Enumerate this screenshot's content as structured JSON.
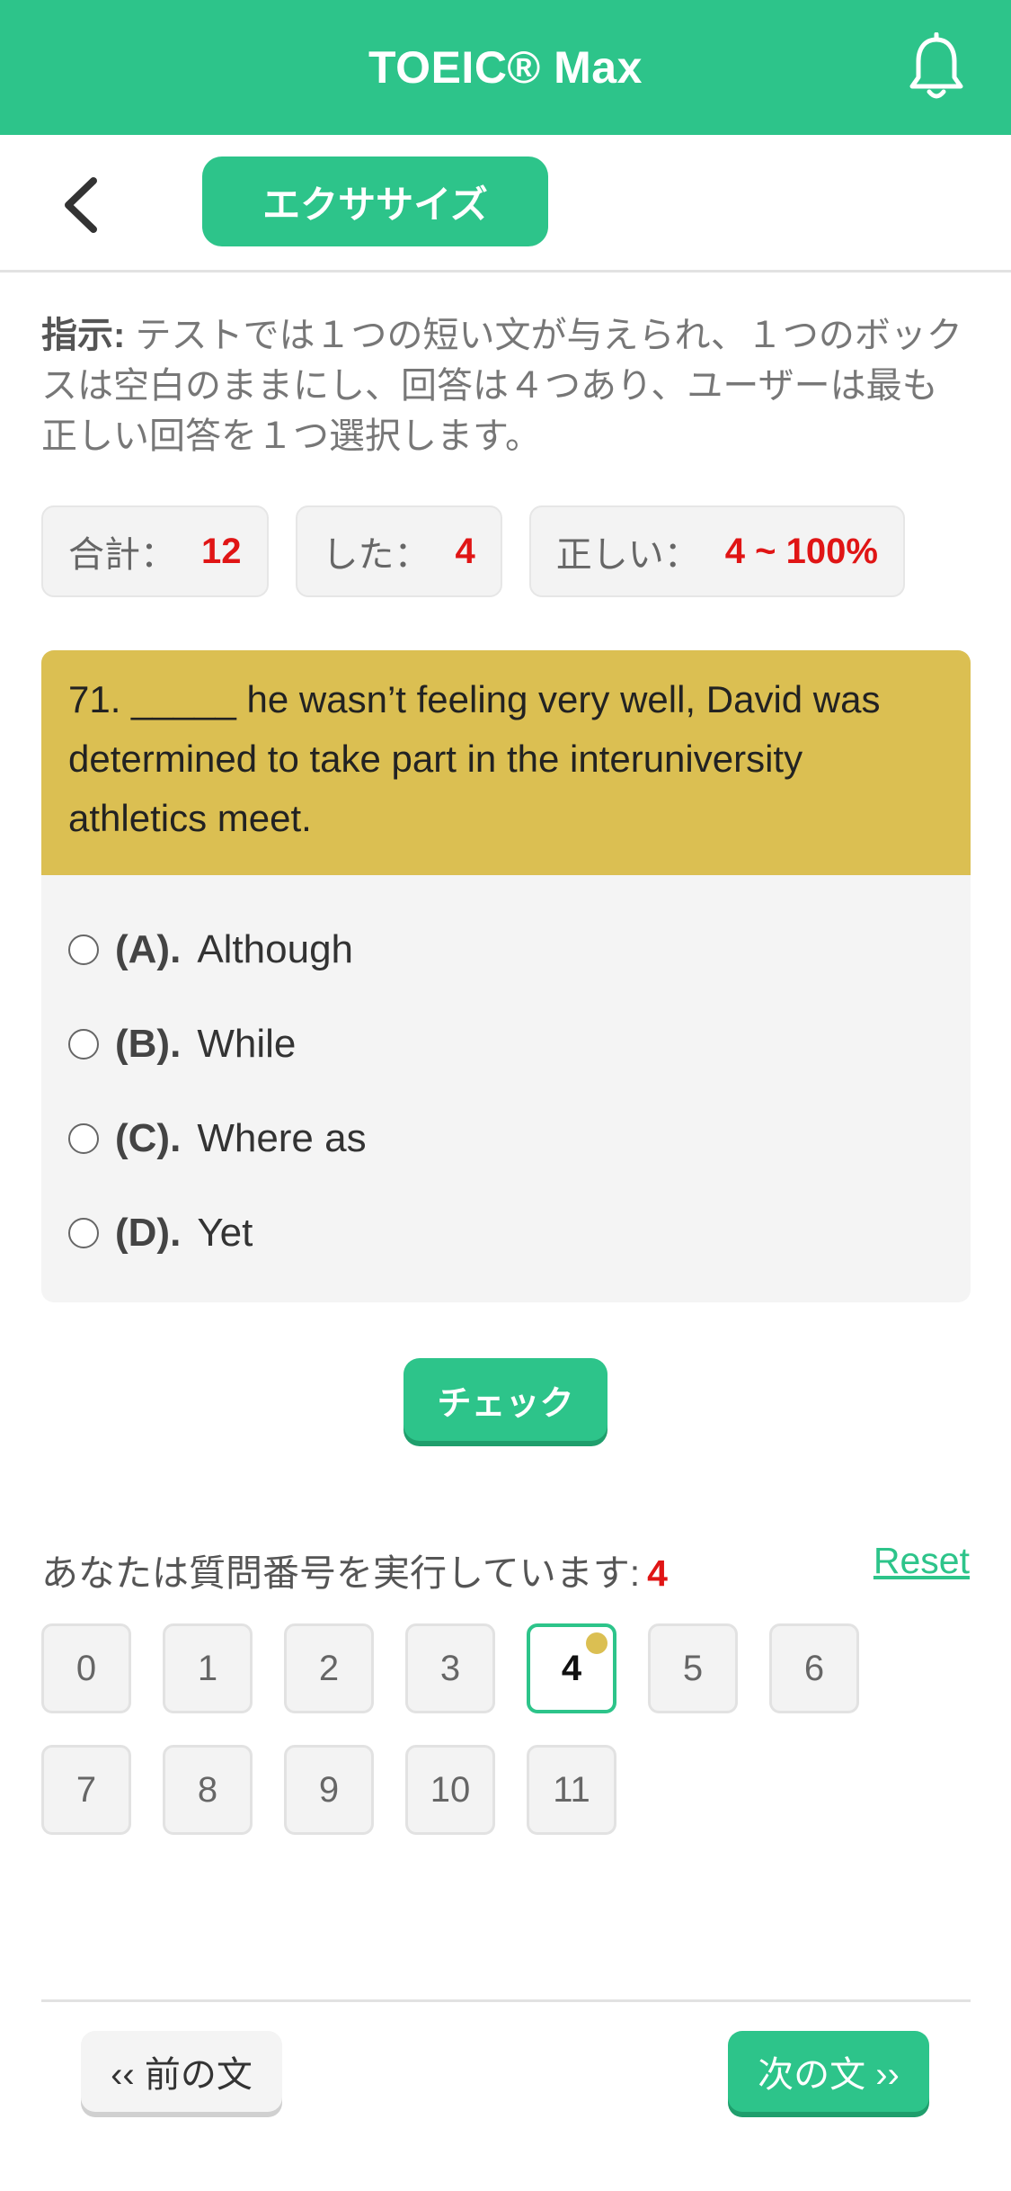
{
  "header": {
    "title": "TOEIC® Max",
    "bell_icon": "bell-icon"
  },
  "subheader": {
    "back_icon": "chevron-left-icon",
    "tab_label": "エクササイズ"
  },
  "instructions": {
    "label": "指示:",
    "text": " テストでは１つの短い文が与えられ、１つのボックスは空白のままにし、回答は４つあり、ユーザーは最も正しい回答を１つ選択します。"
  },
  "stats": {
    "total_label": "合計：",
    "total_value": "12",
    "done_label": "した：",
    "done_value": "4",
    "correct_label": "正しい：",
    "correct_value": "4 ~ 100%"
  },
  "question": {
    "text": "71. _____ he wasn’t feeling very well, David was determined to take part in the interuniversity athletics meet.",
    "options": [
      {
        "key": "(A).",
        "text": "Although"
      },
      {
        "key": "(B).",
        "text": "While"
      },
      {
        "key": "(C).",
        "text": "Where as"
      },
      {
        "key": "(D).",
        "text": "Yet"
      }
    ]
  },
  "check_button": "チェック",
  "progress": {
    "label": "あなたは質問番号を実行しています:",
    "current": "4",
    "reset": "Reset"
  },
  "question_numbers": [
    "0",
    "1",
    "2",
    "3",
    "4",
    "5",
    "6",
    "7",
    "8",
    "9",
    "10",
    "11"
  ],
  "active_question": 4,
  "nav": {
    "prev": "‹‹ 前の文",
    "next": "次の文 ››"
  },
  "colors": {
    "primary": "#2dc48a",
    "question_bg": "#dbbf52",
    "highlight": "#e01515"
  }
}
